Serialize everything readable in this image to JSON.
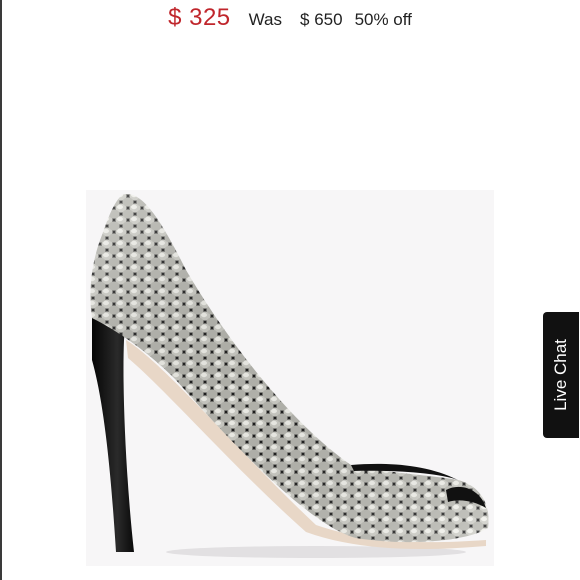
{
  "price": {
    "sale": "$ 325",
    "was_label": "Was",
    "original": "$ 650",
    "discount": "50% off",
    "sale_color": "#c0262c"
  },
  "product": {
    "image_icon": "snakeskin-high-heel-pump"
  },
  "live_chat": {
    "label": "Live Chat"
  }
}
